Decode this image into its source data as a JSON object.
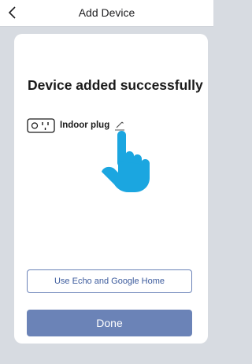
{
  "header": {
    "title": "Add Device",
    "back_icon": "chevron-left-icon"
  },
  "card": {
    "title": "Device added successfully",
    "device": {
      "name": "Indoor plug",
      "icon": "plug-outlet-icon",
      "edit_icon": "pencil-icon"
    },
    "pointer_icon": "pointing-hand-icon",
    "secondary_button_label": "Use Echo and Google Home",
    "primary_button_label": "Done"
  },
  "colors": {
    "background": "#d7dbe1",
    "card": "#ffffff",
    "accent": "#6b83b7",
    "accent_text": "#3b5a9c",
    "hand": "#1ba6e0"
  }
}
